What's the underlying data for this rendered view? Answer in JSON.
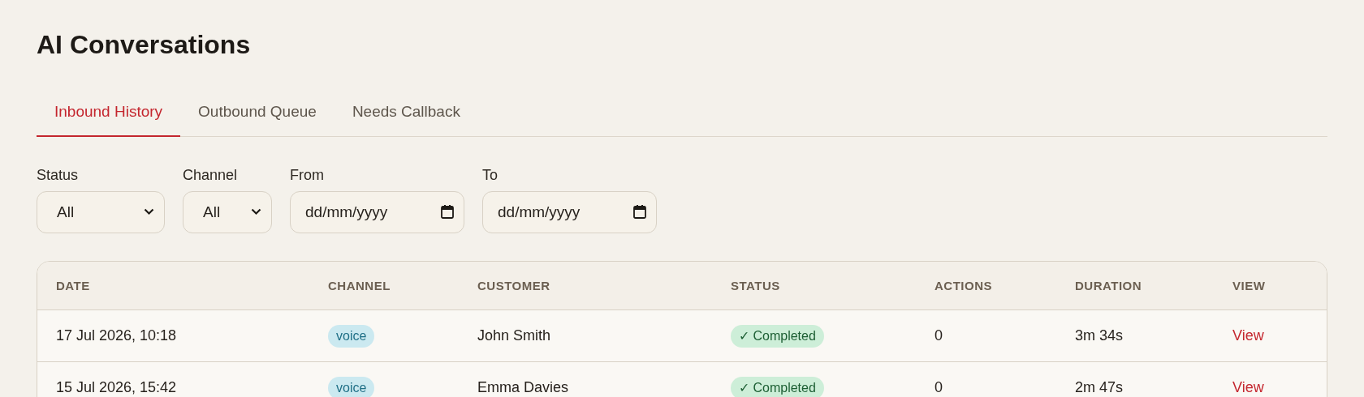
{
  "title": "AI Conversations",
  "tabs": [
    {
      "label": "Inbound History",
      "selected": true
    },
    {
      "label": "Outbound Queue",
      "selected": false
    },
    {
      "label": "Needs Callback",
      "selected": false
    }
  ],
  "filters": [
    {
      "kind": "select",
      "label": "Status",
      "value": "All"
    },
    {
      "kind": "select",
      "label": "Channel",
      "value": "All"
    },
    {
      "kind": "date",
      "label": "From",
      "value": "dd/mm/yyyy"
    },
    {
      "kind": "date",
      "label": "To",
      "value": "dd/mm/yyyy"
    }
  ],
  "table": {
    "columns": [
      "DATE",
      "CHANNEL",
      "CUSTOMER",
      "STATUS",
      "ACTIONS",
      "DURATION",
      "VIEW"
    ],
    "rows": [
      {
        "date": "17 Jul 2026, 10:18",
        "channel": "voice",
        "customer": "John Smith",
        "status": {
          "kind": "completed",
          "label": "✓ Completed"
        },
        "actions": "0",
        "duration": "3m 34s",
        "view": "View"
      },
      {
        "date": "15 Jul 2026, 15:42",
        "channel": "voice",
        "customer": "Emma Davies",
        "status": {
          "kind": "completed",
          "label": "✓ Completed"
        },
        "actions": "0",
        "duration": "2m 47s",
        "view": "View"
      }
    ]
  }
}
